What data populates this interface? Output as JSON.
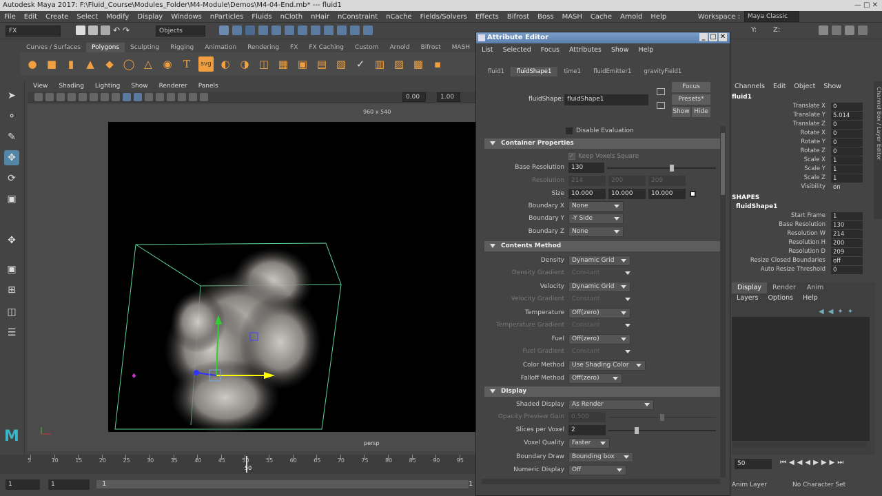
{
  "window": {
    "title": "Autodesk Maya 2017: F:\\Fluid_Course\\Modules_Folder\\M4-Module\\Demos\\M4-04-End.mb*   ---   fluid1",
    "workspace_label": "Workspace :",
    "workspace_value": "Maya Classic"
  },
  "menubar": [
    "File",
    "Edit",
    "Create",
    "Select",
    "Modify",
    "Display",
    "Windows",
    "nParticles",
    "Fluids",
    "nCloth",
    "nHair",
    "nConstraint",
    "nCache",
    "Fields/Solvers",
    "Effects",
    "Bifrost",
    "Boss",
    "MASH",
    "Cache",
    "Arnold",
    "Help"
  ],
  "statusline": {
    "menuset": "FX",
    "selection_mode": "Objects",
    "y_label": "Y:",
    "z_label": "Z:"
  },
  "shelf": {
    "tabs": [
      "Curves / Surfaces",
      "Polygons",
      "Sculpting",
      "Rigging",
      "Animation",
      "Rendering",
      "FX",
      "FX Caching",
      "Custom",
      "Arnold",
      "Bifrost",
      "MASH"
    ],
    "active_tab": "Polygons"
  },
  "viewport": {
    "menu": [
      "View",
      "Shading",
      "Lighting",
      "Show",
      "Renderer",
      "Panels"
    ],
    "field1": "0.00",
    "field2": "1.00",
    "resolution_label": "960 x 540",
    "camera_label": "persp"
  },
  "timeline": {
    "ticks": [
      "5",
      "10",
      "15",
      "20",
      "25",
      "30",
      "35",
      "40",
      "45",
      "50",
      "55",
      "60",
      "65",
      "70",
      "75",
      "80",
      "85",
      "90",
      "95",
      "100"
    ],
    "current_frame": "50",
    "range_start": "1",
    "range_start2": "1",
    "range_knob": "1",
    "range_end": "1"
  },
  "attribute_editor": {
    "title": "Attribute Editor",
    "menu": [
      "List",
      "Selected",
      "Focus",
      "Attributes",
      "Show",
      "Help"
    ],
    "tabs": [
      "fluid1",
      "fluidShape1",
      "time1",
      "fluidEmitter1",
      "gravityField1"
    ],
    "active_tab": "fluidShape1",
    "node_label": "fluidShape:",
    "node_value": "fluidShape1",
    "buttons": {
      "focus": "Focus",
      "presets": "Presets*",
      "show": "Show",
      "hide": "Hide"
    },
    "disable_evaluation": "Disable Evaluation",
    "container": {
      "header": "Container Properties",
      "keep_voxels": "Keep Voxels Square",
      "base_res_label": "Base Resolution",
      "base_res_value": "130",
      "base_res_fraction": 0.6,
      "resolution_label": "Resolution",
      "res_w": "214",
      "res_h": "200",
      "res_d": "209",
      "size_label": "Size",
      "size_x": "10.000",
      "size_y": "10.000",
      "size_z": "10.000",
      "bx_label": "Boundary X",
      "bx_value": "None",
      "by_label": "Boundary Y",
      "by_value": "-Y Side",
      "bz_label": "Boundary Z",
      "bz_value": "None"
    },
    "contents": {
      "header": "Contents Method",
      "density_label": "Density",
      "density_value": "Dynamic Grid",
      "density_grad_label": "Density Gradient",
      "density_grad_value": "Constant",
      "velocity_label": "Velocity",
      "velocity_value": "Dynamic Grid",
      "velocity_grad_label": "Velocity Gradient",
      "velocity_grad_value": "Constant",
      "temperature_label": "Temperature",
      "temperature_value": "Off(zero)",
      "temperature_grad_label": "Temperature Gradient",
      "temperature_grad_value": "Constant",
      "fuel_label": "Fuel",
      "fuel_value": "Off(zero)",
      "fuel_grad_label": "Fuel Gradient",
      "fuel_grad_value": "Constant",
      "color_method_label": "Color Method",
      "color_method_value": "Use Shading Color",
      "falloff_label": "Falloff Method",
      "falloff_value": "Off(zero)"
    },
    "display": {
      "header": "Display",
      "shaded_label": "Shaded Display",
      "shaded_value": "As Render",
      "opacity_label": "Opacity Preview Gain",
      "opacity_value": "0.500",
      "opacity_fraction": 0.5,
      "slices_label": "Slices per Voxel",
      "slices_value": "2",
      "slices_fraction": 0.25,
      "quality_label": "Voxel Quality",
      "quality_value": "Faster",
      "boundary_draw_label": "Boundary Draw",
      "boundary_draw_value": "Bounding box",
      "numeric_label": "Numeric Display",
      "numeric_value": "Off"
    }
  },
  "channel_box": {
    "menu": [
      "Channels",
      "Edit",
      "Object",
      "Show"
    ],
    "node": "fluid1",
    "transform": [
      {
        "k": "Translate X",
        "v": "0"
      },
      {
        "k": "Translate Y",
        "v": "5.014"
      },
      {
        "k": "Translate Z",
        "v": "0"
      },
      {
        "k": "Rotate X",
        "v": "0"
      },
      {
        "k": "Rotate Y",
        "v": "0"
      },
      {
        "k": "Rotate Z",
        "v": "0"
      },
      {
        "k": "Scale X",
        "v": "1"
      },
      {
        "k": "Scale Y",
        "v": "1"
      },
      {
        "k": "Scale Z",
        "v": "1"
      },
      {
        "k": "Visibility",
        "v": "on"
      }
    ],
    "shapes_label": "SHAPES",
    "shape_node": "fluidShape1",
    "shape_attrs": [
      {
        "k": "Start Frame",
        "v": "1"
      },
      {
        "k": "Base Resolution",
        "v": "130"
      },
      {
        "k": "Resolution W",
        "v": "214"
      },
      {
        "k": "Resolution H",
        "v": "200"
      },
      {
        "k": "Resolution D",
        "v": "209"
      },
      {
        "k": "Resize Closed Boundaries",
        "v": "off"
      },
      {
        "k": "Auto Resize Threshold",
        "v": "0"
      }
    ],
    "side_tab": "Channel Box / Layer Editor"
  },
  "layer_editor": {
    "tabs": [
      "Display",
      "Render",
      "Anim"
    ],
    "active_tab": "Display",
    "menu": [
      "Layers",
      "Options",
      "Help"
    ]
  },
  "bottom_right": {
    "frame": "50",
    "anim_layer": "Anim Layer",
    "character_set": "No Character Set"
  }
}
